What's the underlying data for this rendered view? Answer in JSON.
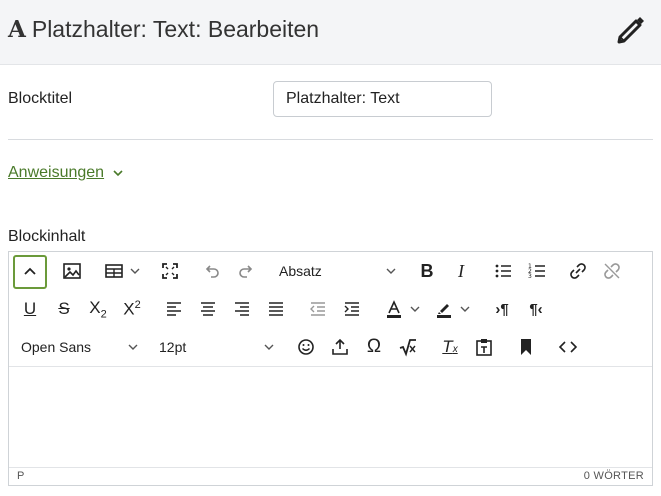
{
  "header": {
    "title": "Platzhalter: Text: Bearbeiten",
    "title_icon": "font-a-icon",
    "edit_icon": "pencil-icon"
  },
  "form": {
    "block_title_label": "Blocktitel",
    "block_title_value": "Platzhalter: Text",
    "instructions_link": "Anweisungen",
    "content_label": "Blockinhalt"
  },
  "editor": {
    "format_select": "Absatz",
    "font_select": "Open Sans",
    "size_select": "12pt",
    "status_path": "P",
    "word_count": "0 WÖRTER"
  },
  "colors": {
    "link": "#4a7a2a",
    "active_border": "#6b9a3a",
    "header_bg": "#f4f5f7"
  }
}
